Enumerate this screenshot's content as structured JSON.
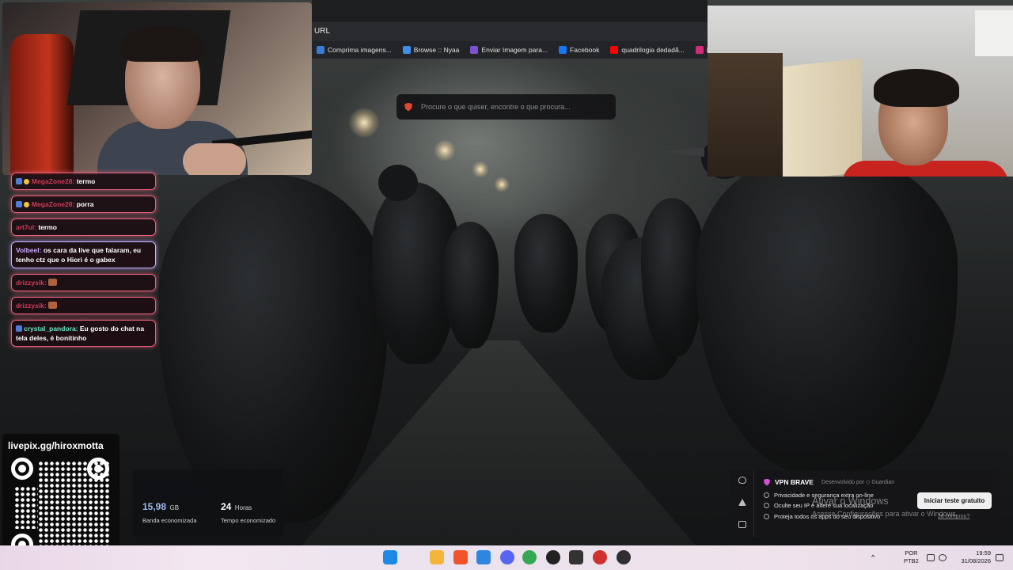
{
  "browser": {
    "url_label": "URL",
    "bookmarks": [
      {
        "label": "Comprima imagens...",
        "color": "#3a7bd5"
      },
      {
        "label": "Browse :: Nyaa",
        "color": "#3f8ee8"
      },
      {
        "label": "Enviar Imagem para...",
        "color": "#7a52d0"
      },
      {
        "label": "Facebook",
        "color": "#1877f2"
      },
      {
        "label": "quadrilogia dedadã...",
        "color": "#ff0000"
      },
      {
        "label": "Instag",
        "color": "#d62976"
      }
    ],
    "search_placeholder": "Procure o que quiser, encontre o que procura..."
  },
  "chat": [
    {
      "user": "MegaZone28:",
      "text": "termo",
      "style": "pink",
      "badges": 2
    },
    {
      "user": "MegaZone28:",
      "text": "porra",
      "style": "pink",
      "badges": 2
    },
    {
      "user": "art7ul:",
      "text": "termo",
      "style": "pink",
      "badges": 0
    },
    {
      "user": "Volbeel:",
      "text": "os cara da live que falaram, eu tenho ctz que o Hiori é o gabex",
      "style": "purple",
      "badges": 0
    },
    {
      "user": "drizzysik:",
      "text": "",
      "style": "pink",
      "badges": 0,
      "emote": true
    },
    {
      "user": "drizzysik:",
      "text": "",
      "style": "pink",
      "badges": 0,
      "emote": true
    },
    {
      "user": "crystal_pandora:",
      "text": "Eu gosto do chat na tela deles, é bonitinho",
      "style": "pink",
      "badges": 1
    }
  ],
  "livepix": {
    "title": "livepix.gg/hiroxmotta"
  },
  "stats": {
    "band_value": "15,98",
    "band_unit": "GB",
    "band_label": "Banda economizada",
    "time_value": "24",
    "time_unit": "Horas",
    "time_label": "Tempo economizado"
  },
  "vpn": {
    "title": "VPN BRAVE",
    "developer": "Desenvolvido por ◇ Guardian",
    "features": [
      "Privacidade e segurança extra on-line",
      "Oculte seu IP e altere sua localização",
      "Proteja todos os apps do seu dispositivo"
    ],
    "cta": "Iniciar teste gratuito",
    "dismiss": "Já comprou?"
  },
  "windows_activation": {
    "title": "Ativar o Windows",
    "subtitle": "Acesse Configurações para ativar o Windows."
  },
  "taskbar": {
    "lang": "POR",
    "layout": "PTB2",
    "time": "19:59",
    "date": "31/08/2026",
    "apps": [
      {
        "name": "windows-start-icon",
        "color": "#1e88e5"
      },
      {
        "name": "file-explorer-icon",
        "color": "#f3b63a"
      },
      {
        "name": "brave-browser-icon",
        "color": "#f0532a"
      },
      {
        "name": "notepad-icon",
        "color": "#2e86de"
      },
      {
        "name": "discord-icon",
        "color": "#5865f2"
      },
      {
        "name": "chrome-icon",
        "color": "#34a853"
      },
      {
        "name": "g-app-icon",
        "color": "#222222"
      },
      {
        "name": "media-app-icon",
        "color": "#333333"
      },
      {
        "name": "red-app-icon",
        "color": "#d0312d"
      },
      {
        "name": "obs-icon",
        "color": "#302e31"
      }
    ]
  }
}
